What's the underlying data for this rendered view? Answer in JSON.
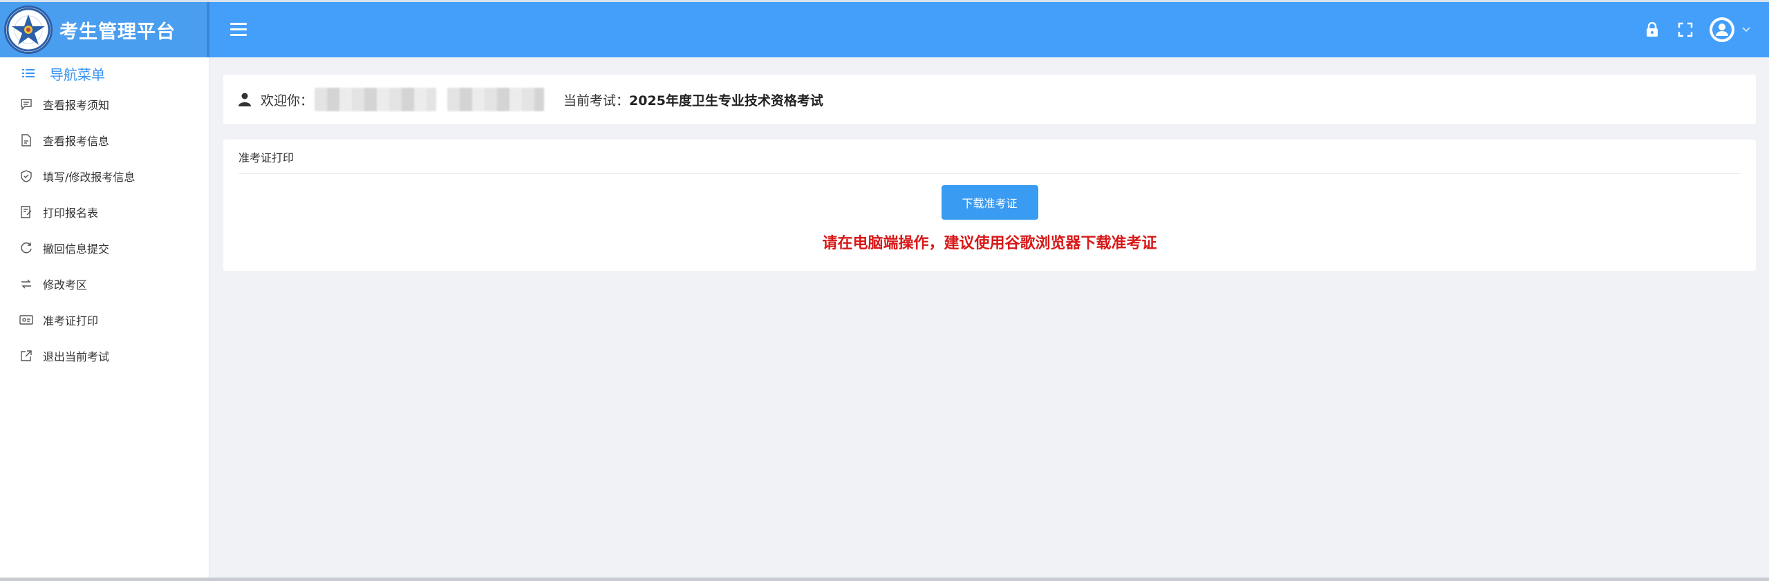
{
  "header": {
    "brand_title": "考生管理平台",
    "bg_color": "#439ff9"
  },
  "sidebar": {
    "nav_title": "导航菜单",
    "items": [
      {
        "label": "查看报考须知",
        "icon": "message-icon"
      },
      {
        "label": "查看报考信息",
        "icon": "document-icon"
      },
      {
        "label": "填写/修改报考信息",
        "icon": "shield-check-icon"
      },
      {
        "label": "打印报名表",
        "icon": "form-icon"
      },
      {
        "label": "撤回信息提交",
        "icon": "refresh-icon"
      },
      {
        "label": "修改考区",
        "icon": "switch-icon"
      },
      {
        "label": "准考证打印",
        "icon": "id-card-icon"
      },
      {
        "label": "退出当前考试",
        "icon": "exit-icon"
      }
    ]
  },
  "welcome": {
    "greeting": "欢迎你：",
    "exam_label": "当前考试：",
    "exam_name": "2025年度卫生专业技术资格考试"
  },
  "print_card": {
    "title": "准考证打印",
    "download_button": "下载准考证",
    "warning": "请在电脑端操作，建议使用谷歌浏览器下载准考证",
    "warning_color": "#d81818",
    "button_color": "#3a9bf2"
  }
}
